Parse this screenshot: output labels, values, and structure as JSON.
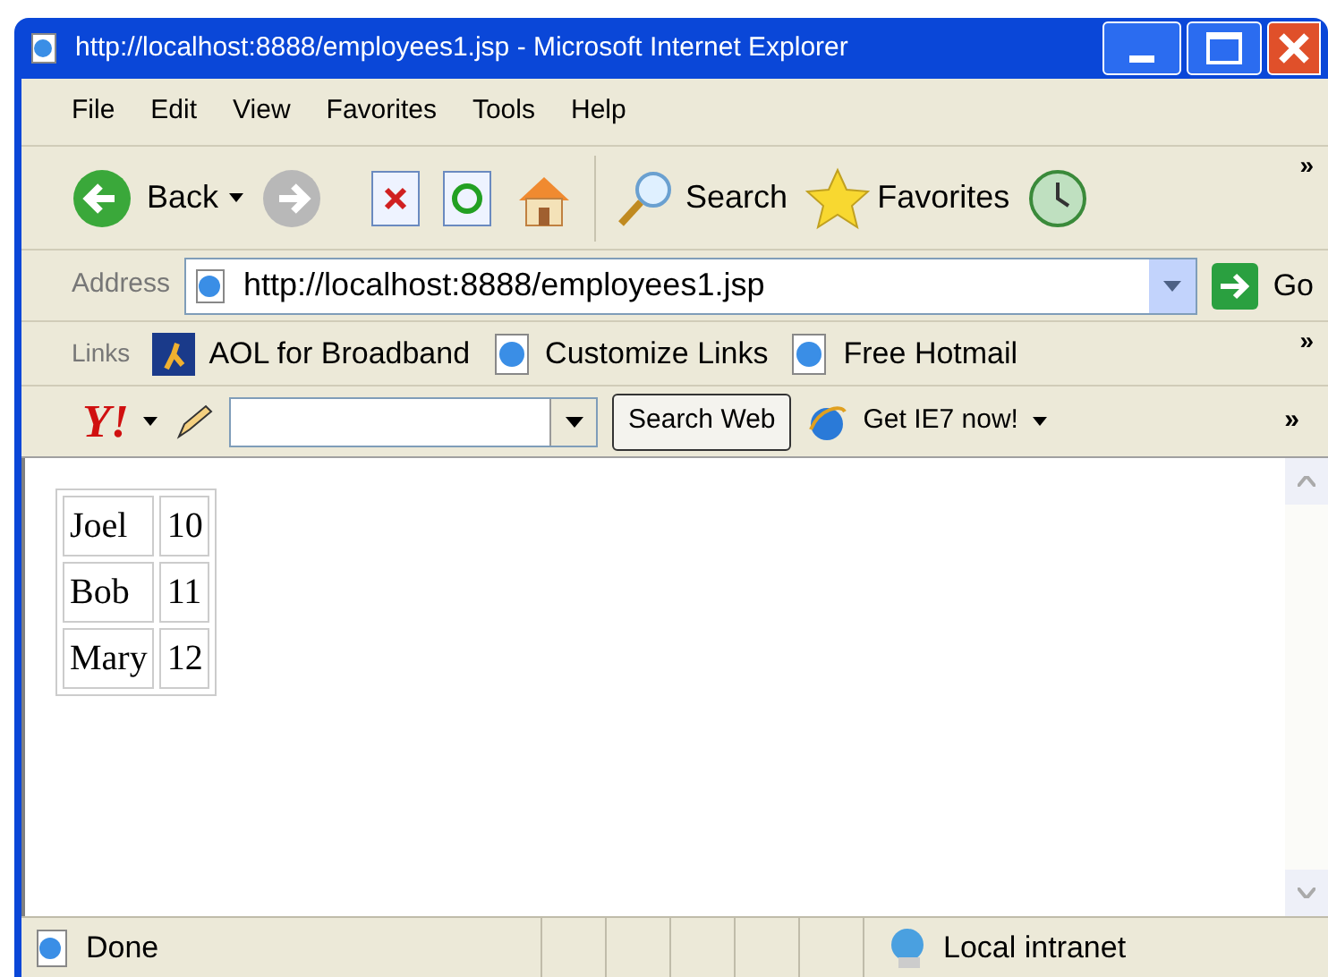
{
  "window": {
    "title": "http://localhost:8888/employees1.jsp - Microsoft Internet Explorer"
  },
  "menu": [
    "File",
    "Edit",
    "View",
    "Favorites",
    "Tools",
    "Help"
  ],
  "toolbar": {
    "back": "Back",
    "search": "Search",
    "favorites": "Favorites",
    "more": "»"
  },
  "address": {
    "label": "Address",
    "value": "http://localhost:8888/employees1.jsp",
    "go": "Go"
  },
  "links": {
    "label": "Links",
    "items": [
      "AOL for Broadband",
      "Customize Links",
      "Free Hotmail"
    ],
    "more": "»"
  },
  "yahoo_bar": {
    "logo": "Y!",
    "search_button": "Search Web",
    "ie7": "Get IE7 now!",
    "more": "»"
  },
  "table": {
    "rows": [
      [
        "Joel",
        "10"
      ],
      [
        "Bob",
        "11"
      ],
      [
        "Mary",
        "12"
      ]
    ]
  },
  "status_bar": {
    "text": "Done",
    "zone": "Local intranet"
  }
}
